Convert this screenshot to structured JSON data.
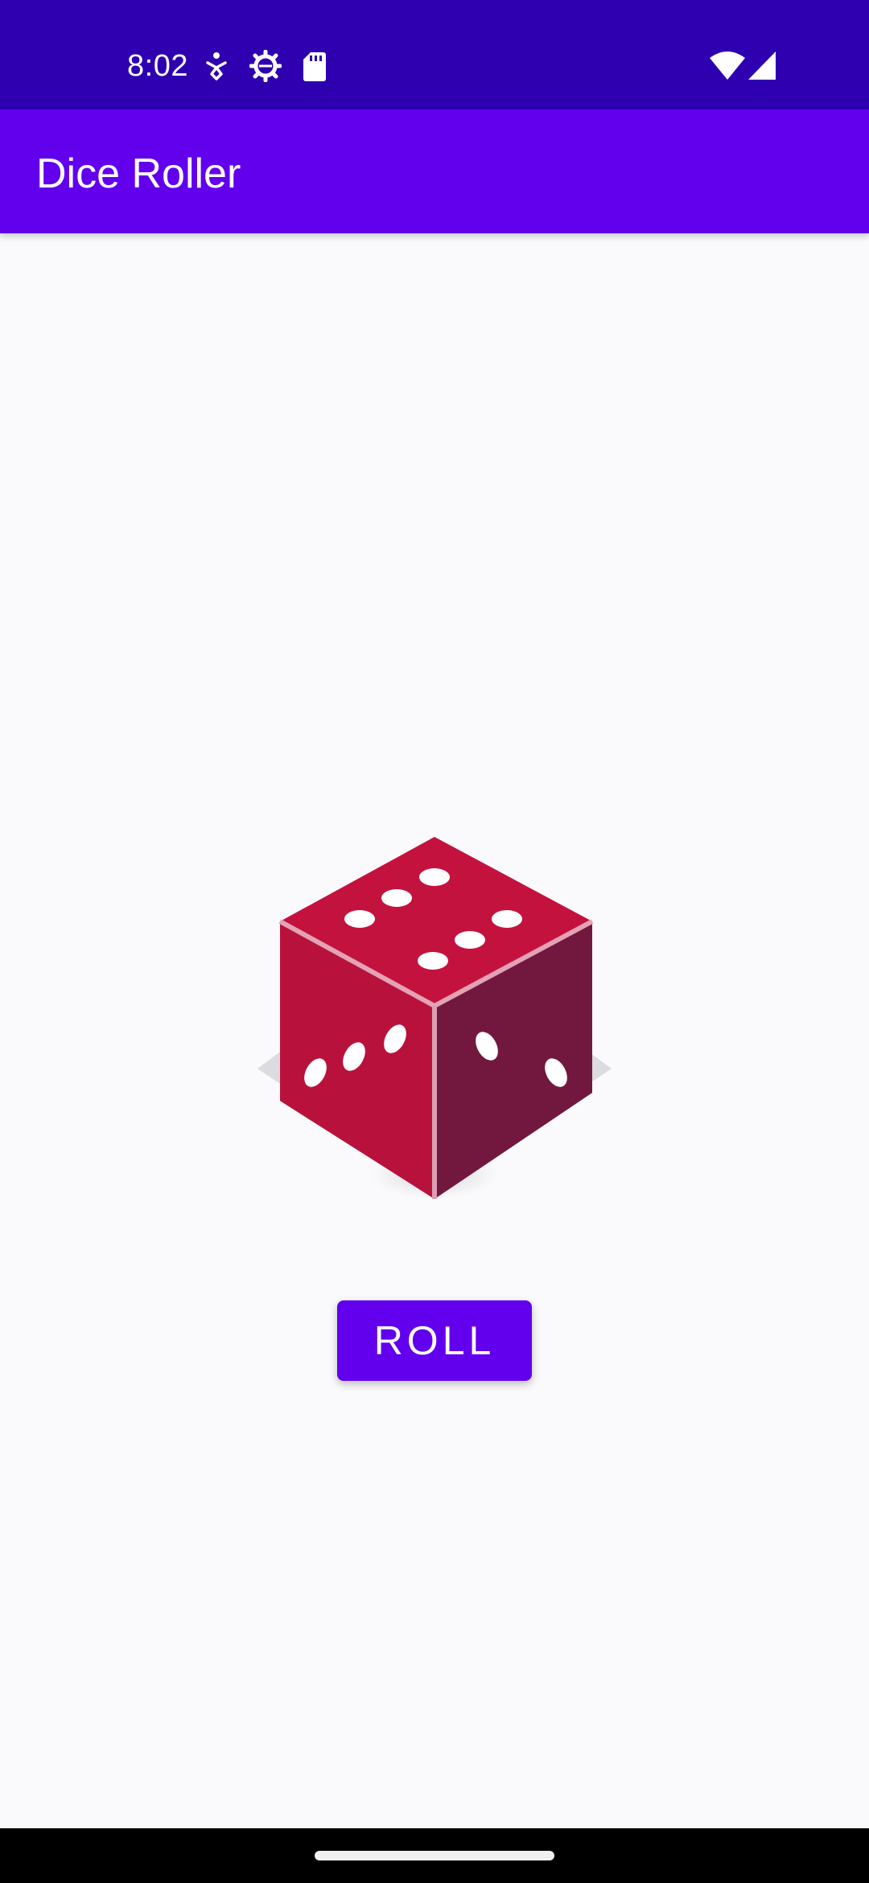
{
  "status_bar": {
    "time": "8:02",
    "icons": [
      "accessibility-icon",
      "settings-gear-icon",
      "sd-card-icon",
      "wifi-icon",
      "cell-signal-icon"
    ],
    "background": "#2e00b0"
  },
  "app_bar": {
    "title": "Dice Roller",
    "background": "#6200ee"
  },
  "dice": {
    "top_face_value": 6,
    "left_face_value": 3,
    "right_face_value": 2,
    "color": "#c2123f"
  },
  "roll_button": {
    "label": "ROLL",
    "color": "#6200ee"
  }
}
